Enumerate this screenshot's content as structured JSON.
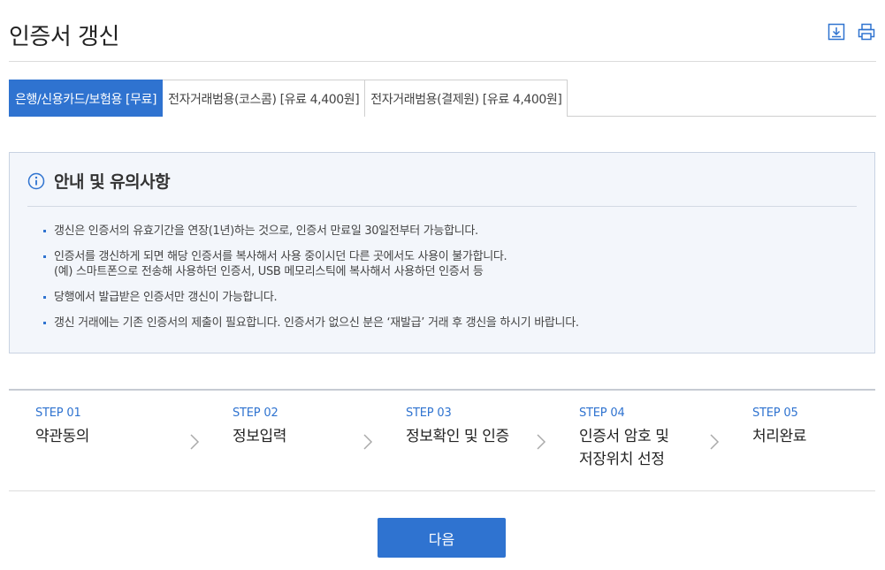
{
  "header": {
    "title": "인증서 갱신",
    "icons": [
      "download-icon",
      "print-icon"
    ]
  },
  "tabs": [
    {
      "label": "은행/신용카드/보험용 [무료]",
      "active": true
    },
    {
      "label": "전자거래범용(코스콤) [유료 4,400원]",
      "active": false
    },
    {
      "label": "전자거래범용(결제원) [유료 4,400원]",
      "active": false
    }
  ],
  "notice": {
    "title": "안내 및 유의사항",
    "items": [
      {
        "text": "갱신은 인증서의 유효기간을 연장(1년)하는 것으로, 인증서 만료일 30일전부터 가능합니다."
      },
      {
        "text": "인증서를 갱신하게 되면 해당 인증서를 복사해서 사용 중이시던 다른 곳에서도 사용이 불가합니다.",
        "sub": "(예) 스마트폰으로 전송해 사용하던 인증서, USB 메모리스틱에 복사해서 사용하던 인증서 등"
      },
      {
        "text": "당행에서 발급받은 인증서만 갱신이 가능합니다."
      },
      {
        "text": "갱신 거래에는 기존 인증서의 제출이 필요합니다. 인증서가 없으신 분은 ‘재발급’ 거래 후 갱신을 하시기 바랍니다."
      }
    ]
  },
  "steps": [
    {
      "num": "STEP 01",
      "label": "약관동의"
    },
    {
      "num": "STEP 02",
      "label": "정보입력"
    },
    {
      "num": "STEP 03",
      "label": "정보확인 및 인증"
    },
    {
      "num": "STEP 04",
      "label": "인증서 암호 및",
      "label2": "저장위치 선정"
    },
    {
      "num": "STEP 05",
      "label": "처리완료"
    }
  ],
  "colors": {
    "accent": "#2f73d0",
    "notice_bg": "#f3f6fb"
  },
  "next_button": {
    "label": "다음"
  }
}
